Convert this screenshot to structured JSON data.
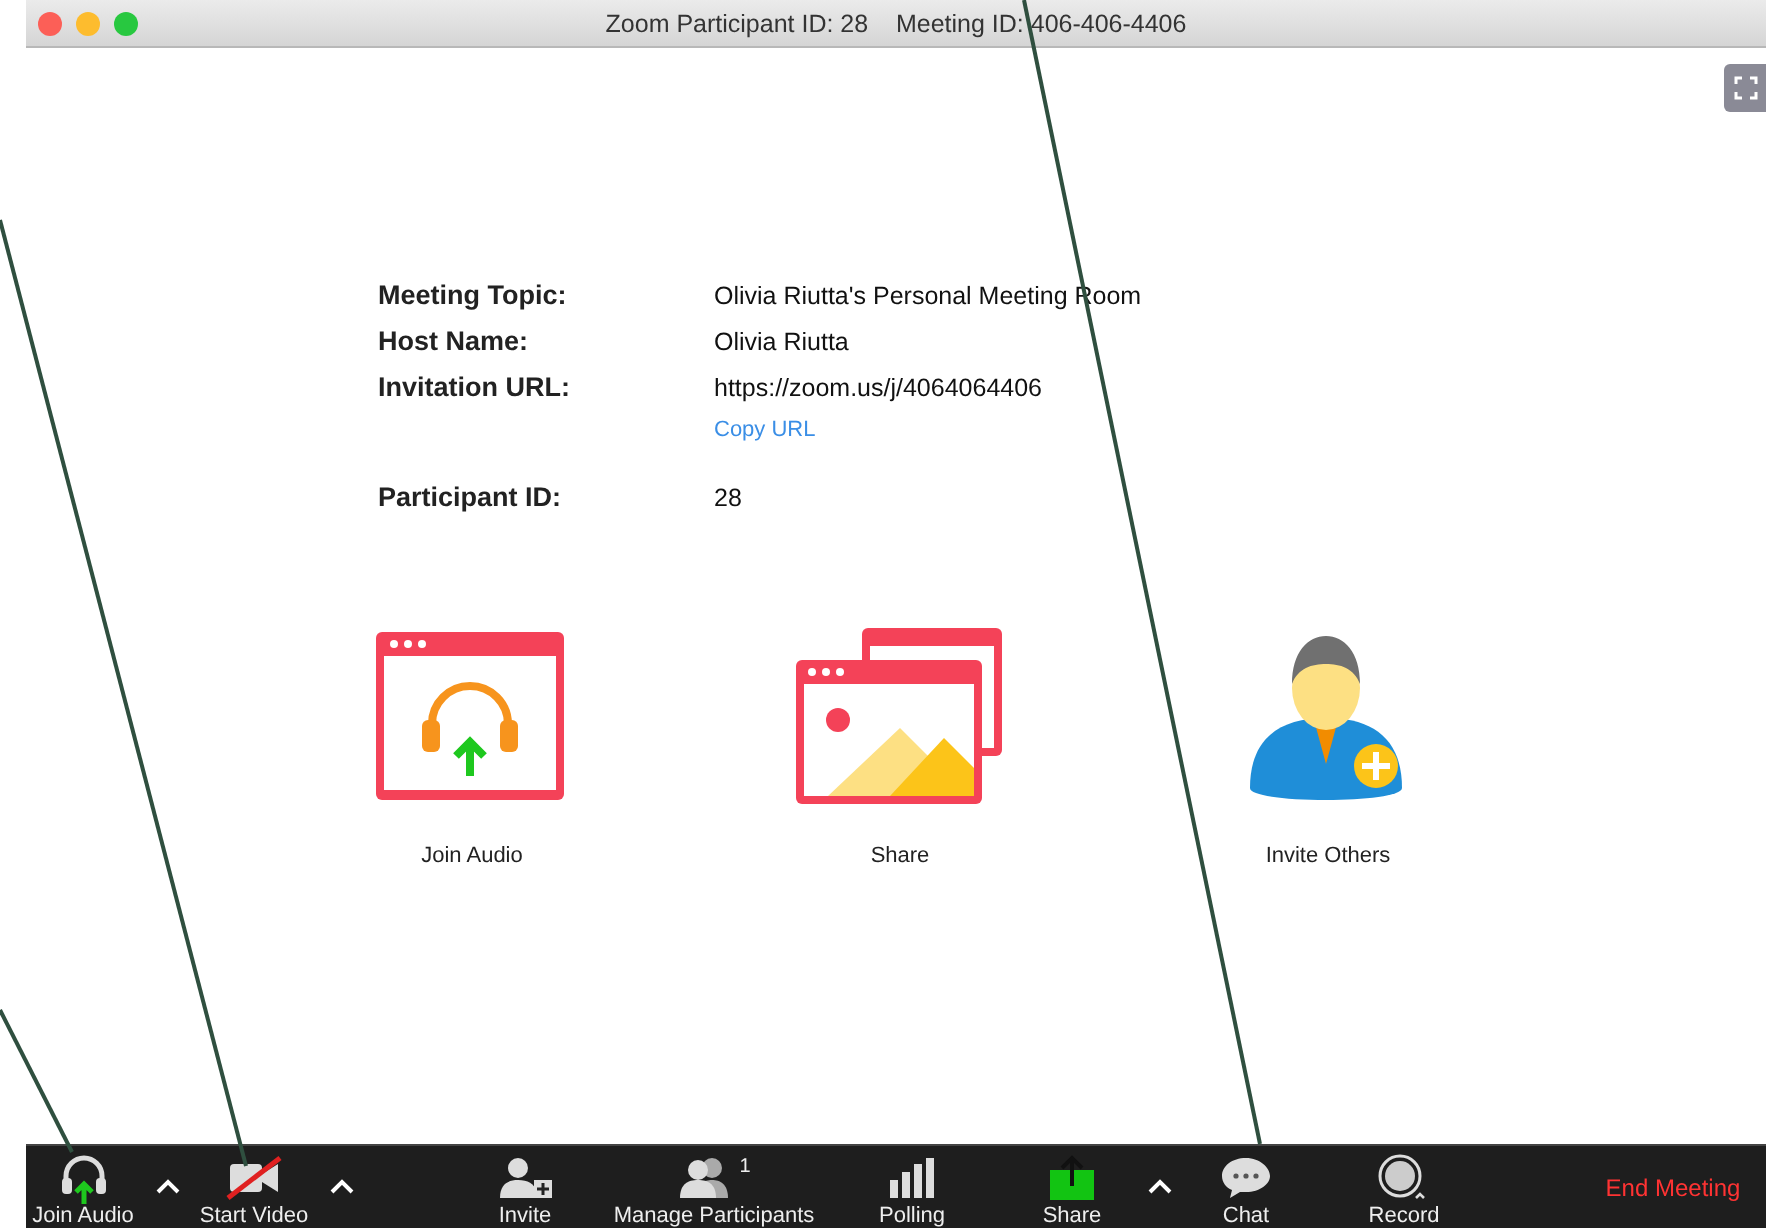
{
  "window": {
    "title": "Zoom Participant ID: 28    Meeting ID: 406-406-4406"
  },
  "info": [
    {
      "label": "Meeting Topic:",
      "value": "Olivia Riutta's Personal Meeting Room"
    },
    {
      "label": "Host Name:",
      "value": "Olivia Riutta"
    },
    {
      "label": "Invitation URL:",
      "value": "https://zoom.us/j/4064064406",
      "link": "Copy URL"
    },
    {
      "label": "Participant ID:",
      "value": "28"
    }
  ],
  "actions": [
    {
      "kind": "audio",
      "label": "Join Audio"
    },
    {
      "kind": "share",
      "label": "Share"
    },
    {
      "kind": "invite",
      "label": "Invite Others"
    }
  ],
  "toolbar": [
    {
      "kind": "audio",
      "label": "Join Audio"
    },
    {
      "kind": "caret"
    },
    {
      "kind": "video",
      "label": "Start Video",
      "off": true
    },
    {
      "kind": "caret"
    },
    {
      "kind": "invite",
      "label": "Invite"
    },
    {
      "kind": "participants",
      "label": "Manage Participants",
      "badge": "1"
    },
    {
      "kind": "polling",
      "label": "Polling"
    },
    {
      "kind": "share",
      "label": "Share"
    },
    {
      "kind": "caret"
    },
    {
      "kind": "chat",
      "label": "Chat"
    },
    {
      "kind": "record",
      "label": "Record"
    },
    {
      "kind": "end",
      "label": "End Meeting"
    }
  ]
}
